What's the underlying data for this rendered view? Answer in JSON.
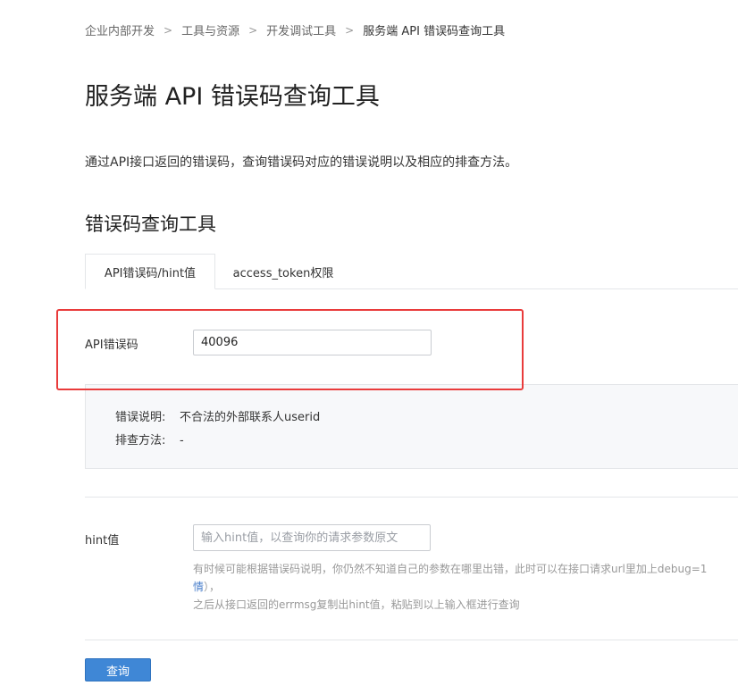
{
  "breadcrumb": {
    "items": [
      "企业内部开发",
      "工具与资源",
      "开发调试工具"
    ],
    "separator": ">",
    "current": "服务端 API 错误码查询工具"
  },
  "page": {
    "title": "服务端 API 错误码查询工具",
    "description": "通过API接口返回的错误码，查询错误码对应的错误说明以及相应的排查方法。"
  },
  "section": {
    "title": "错误码查询工具"
  },
  "tabs": [
    {
      "label": "API错误码/hint值",
      "active": true
    },
    {
      "label": "access_token权限",
      "active": false
    }
  ],
  "form": {
    "code_label": "API错误码",
    "code_value": "40096",
    "hint_label": "hint值",
    "hint_placeholder": "输入hint值，以查询你的请求参数原文",
    "hint_value": ""
  },
  "result": {
    "desc_key": "错误说明:",
    "desc_value": "不合法的外部联系人userid",
    "fix_key": "排查方法:",
    "fix_value": "-"
  },
  "help": {
    "line1": "有时候可能根据错误码说明，你仍然不知道自己的参数在哪里出错，此时可以在接口请求url里加上debug=1",
    "line2_link": "情",
    "line2_rest": "），",
    "line3": "之后从接口返回的errmsg复制出hint值，粘贴到以上输入框进行查询"
  },
  "actions": {
    "query_label": "查询"
  },
  "colors": {
    "highlight": "#e93b3b",
    "primary": "#3f87d6",
    "link": "#4a7fcb"
  }
}
